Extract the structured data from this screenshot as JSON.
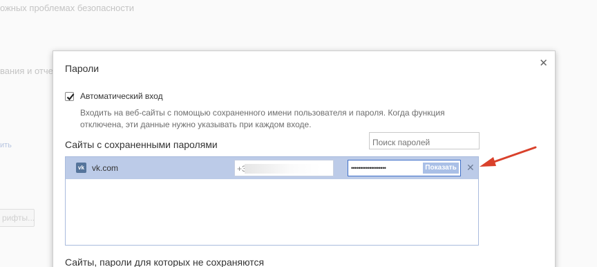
{
  "background": {
    "line1": "ожных проблемах безопасности",
    "line2": "вания и отчет",
    "link": "ить",
    "button": "рифты..."
  },
  "dialog": {
    "title": "Пароли",
    "close_icon": "✕",
    "auto_login": {
      "label": "Автоматический вход",
      "checked": true,
      "description": "Входить на веб-сайты с помощью сохраненного имени пользователя и пароля. Когда функция отключена, эти данные нужно указывать при каждом входе."
    },
    "saved_section_title": "Сайты с сохраненными паролями",
    "search_placeholder": "Поиск паролей",
    "saved_items": [
      {
        "site": "vk.com",
        "username_visible": "+3",
        "password_mask": "•••••••••••••••••••",
        "show_label": "Показать",
        "remove_icon": "✕"
      }
    ],
    "never_saved_title": "Сайты, пароли для которых не сохраняются"
  },
  "colors": {
    "selected_row": "#bccbe8",
    "arrow": "#d9412b",
    "focus_border": "#3e6fc8"
  }
}
